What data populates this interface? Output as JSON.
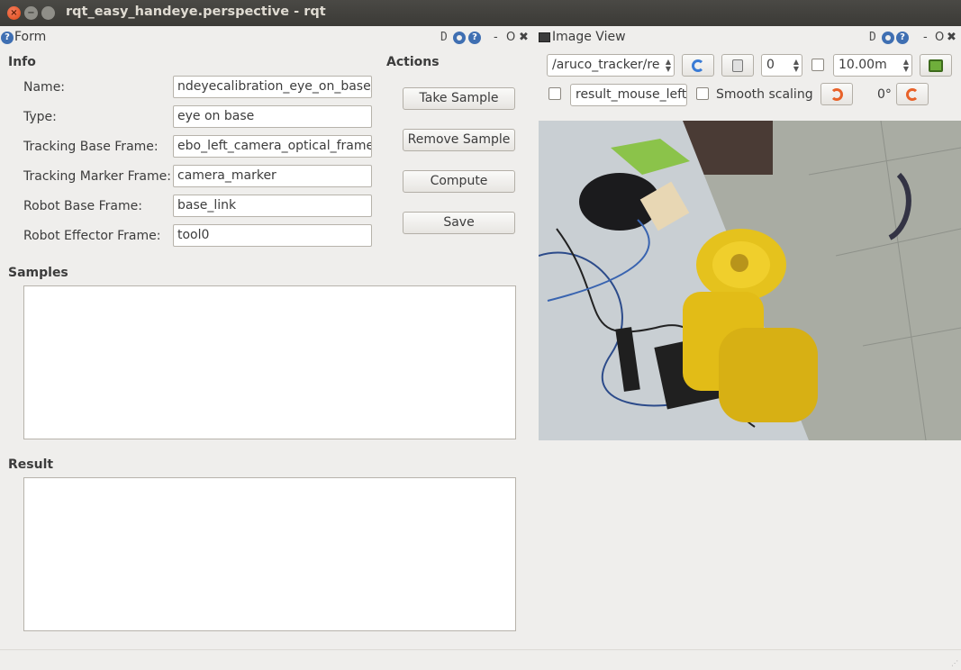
{
  "window": {
    "title": "rqt_easy_handeye.perspective - rqt"
  },
  "form_dock": {
    "title": "Form",
    "controls": {
      "d": "D",
      "minimize": "-",
      "restore": "O",
      "close": "✖"
    }
  },
  "image_dock": {
    "title": "Image View",
    "controls": {
      "d": "D",
      "minimize": "-",
      "restore": "O",
      "close": "✖"
    }
  },
  "info": {
    "title": "Info",
    "fields": [
      {
        "label": "Name:",
        "value": "ndeyecalibration_eye_on_base/"
      },
      {
        "label": "Type:",
        "value": "eye on base"
      },
      {
        "label": "Tracking Base Frame:",
        "value": "ebo_left_camera_optical_frame"
      },
      {
        "label": "Tracking Marker Frame:",
        "value": "camera_marker"
      },
      {
        "label": "Robot Base Frame:",
        "value": "base_link"
      },
      {
        "label": "Robot Effector Frame:",
        "value": "tool0"
      }
    ]
  },
  "actions": {
    "title": "Actions",
    "take_sample": "Take Sample",
    "remove_sample": "Remove Sample",
    "compute": "Compute",
    "save": "Save"
  },
  "samples": {
    "title": "Samples"
  },
  "result": {
    "title": "Result"
  },
  "image_view": {
    "topic": "/aruco_tracker/re",
    "spin_value": "0",
    "max_range": "10.00m",
    "mouse_topic": "result_mouse_left",
    "smooth_scaling_label": "Smooth scaling",
    "rotation": "0°",
    "icons": {
      "refresh": "refresh-icon",
      "save": "save-image-icon",
      "rotate_left": "rotate-left-icon",
      "rotate_right": "rotate-right-icon"
    }
  },
  "colors": {
    "title_bar": "#3f3e3a",
    "background": "#efeeec",
    "accent_blue": "#3f6fb2",
    "close_orange": "#df4a16"
  }
}
